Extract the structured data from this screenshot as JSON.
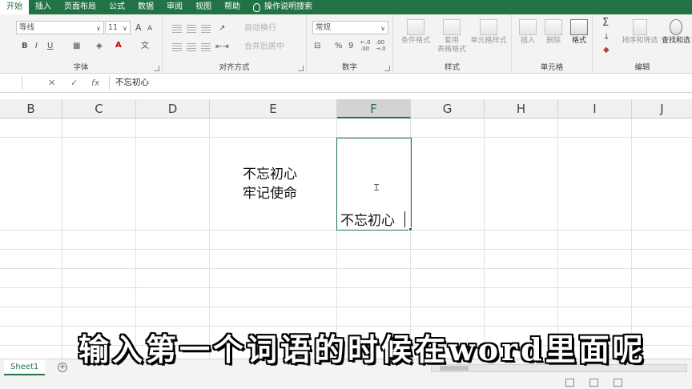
{
  "ribbon_tabs": [
    "开始",
    "插入",
    "页面布局",
    "公式",
    "数据",
    "审阅",
    "视图",
    "帮助"
  ],
  "tell_me": "操作说明搜索",
  "font": {
    "name": "等线",
    "size": "11",
    "bold": "B",
    "italic": "I",
    "underline": "U",
    "grow": "A",
    "shrink": "A",
    "font_color": "A",
    "phonetic": "文"
  },
  "alignment": {
    "wrap_text": "自动换行",
    "merge_center": "合并后居中"
  },
  "number": {
    "format": "常规",
    "percent": "%",
    "comma": "9",
    "inc_decimal": "←.0 .00",
    "dec_decimal": ".00 →.0"
  },
  "styles": {
    "conditional": "条件格式",
    "table_format_1": "套用",
    "table_format_2": "表格格式",
    "cell_styles": "单元格样式"
  },
  "cells": {
    "insert": "插入",
    "delete": "删除",
    "format": "格式"
  },
  "editing": {
    "sort_filter": "排序和筛选",
    "find_select": "查找和选",
    "sum": "Σ"
  },
  "group_labels": {
    "font": "字体",
    "alignment": "对齐方式",
    "number": "数字",
    "styles": "样式",
    "cells": "单元格",
    "editing": "编辑"
  },
  "formula_bar": {
    "cancel": "✕",
    "enter": "✓",
    "fx": "fx",
    "content": "不忘初心"
  },
  "columns": [
    "B",
    "C",
    "D",
    "E",
    "F",
    "G",
    "H",
    "I",
    "J"
  ],
  "cells_content": {
    "e_line1": "不忘初心",
    "e_line2": "牢记使命",
    "f_editing": "不忘初心"
  },
  "sheet_tab": "Sheet1",
  "add_sheet": "+",
  "subtitle": "输入第一个词语的时候在word里面呢",
  "colors": {
    "excel_green": "#217346",
    "ribbon_bg": "#f3f3f3"
  }
}
